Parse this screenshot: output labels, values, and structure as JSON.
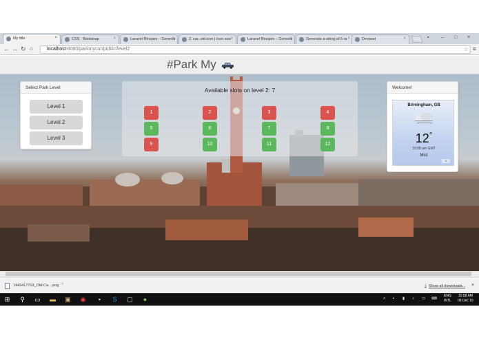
{
  "browser": {
    "tabs": [
      {
        "title": "My title",
        "active": true
      },
      {
        "title": "CSS · Bootstrap",
        "active": false
      },
      {
        "title": "Laravel Recipes :: Generat",
        "active": false
      },
      {
        "title": "2. car, old icon | Icon sea",
        "active": false
      },
      {
        "title": "Laravel Recipes :: Generat",
        "active": false
      },
      {
        "title": "Generate a string of 5 ra",
        "active": false
      },
      {
        "title": "Devpost",
        "active": false
      }
    ],
    "close_glyph": "×",
    "url_host": "localhost",
    "url_path": ":8080/parkmycar/public/level2",
    "window_controls": [
      "–",
      "□",
      "×"
    ]
  },
  "page": {
    "brand": "#Park My",
    "car_icon": "car-icon",
    "level_panel": {
      "title": "Select Park Level",
      "levels": [
        "Level 1",
        "Level 2",
        "Level 3"
      ]
    },
    "slots": {
      "title": "Available slots on level 2: 7",
      "items": [
        {
          "number": "1",
          "status": "taken"
        },
        {
          "number": "2",
          "status": "taken"
        },
        {
          "number": "3",
          "status": "taken"
        },
        {
          "number": "4",
          "status": "taken"
        },
        {
          "number": "5",
          "status": "free"
        },
        {
          "number": "6",
          "status": "free"
        },
        {
          "number": "7",
          "status": "free"
        },
        {
          "number": "8",
          "status": "free"
        },
        {
          "number": "9",
          "status": "taken"
        },
        {
          "number": "10",
          "status": "free"
        },
        {
          "number": "11",
          "status": "free"
        },
        {
          "number": "12",
          "status": "free"
        }
      ]
    },
    "welcome": {
      "title": "Welcome!",
      "city": "Birmingham, GB",
      "temperature": "12",
      "degree": "°",
      "time": "10:58 am GMT",
      "condition": "Mist"
    }
  },
  "downloads": {
    "file": "1449417703_Old-Ca....png",
    "show_all": "Show all downloads...",
    "close": "×"
  },
  "taskbar": {
    "lang": "ENG",
    "region": "INTL",
    "time": "10:58 AM",
    "date": "06 Dec 15"
  },
  "colors": {
    "taken": "#d9534f",
    "free": "#5cb85c",
    "taskbar": "#101010"
  }
}
